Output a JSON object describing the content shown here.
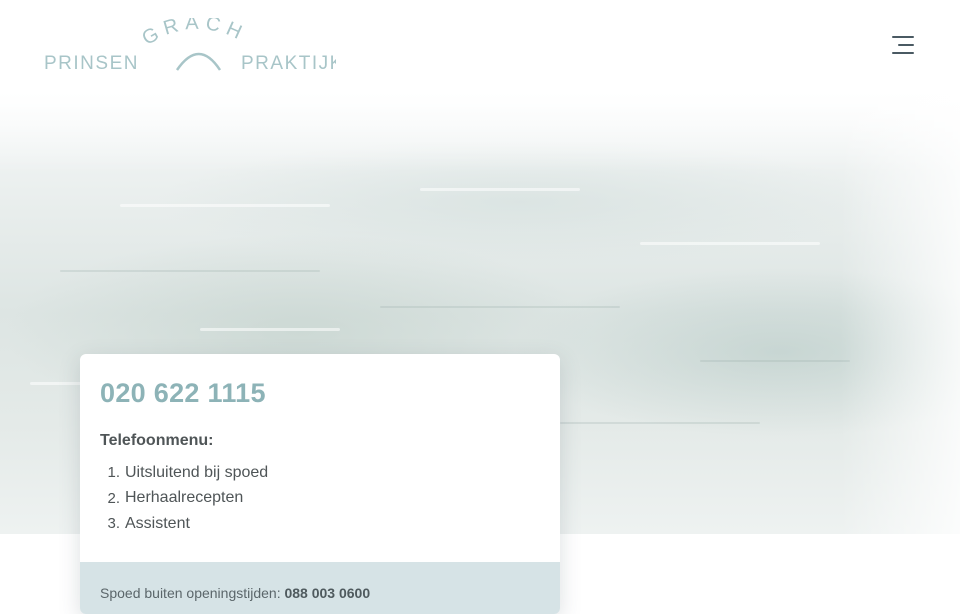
{
  "header": {
    "logo": {
      "left_word": "PRINSEN",
      "arc_word": "GRACHT",
      "right_word": "PRAKTIJK",
      "color": "#a8c5c8"
    },
    "menu_icon": "hamburger-menu-icon"
  },
  "hero": {
    "image": "blurred-canal-water-scene"
  },
  "contact_card": {
    "phone": "020 622 1115",
    "menu_title": "Telefoonmenu:",
    "menu_items": [
      {
        "num": "1.",
        "label": "Uitsluitend bij spoed"
      },
      {
        "num": "2.",
        "label": "Herhaalrecepten"
      },
      {
        "num": "3.",
        "label": "Assistent"
      }
    ],
    "emergency": {
      "text": "Spoed buiten openingstijden:",
      "number": "088 003 0600"
    }
  },
  "colors": {
    "accent": "#8db3b7",
    "text": "#4f5557",
    "emergency_bg": "#d6e3e6"
  }
}
